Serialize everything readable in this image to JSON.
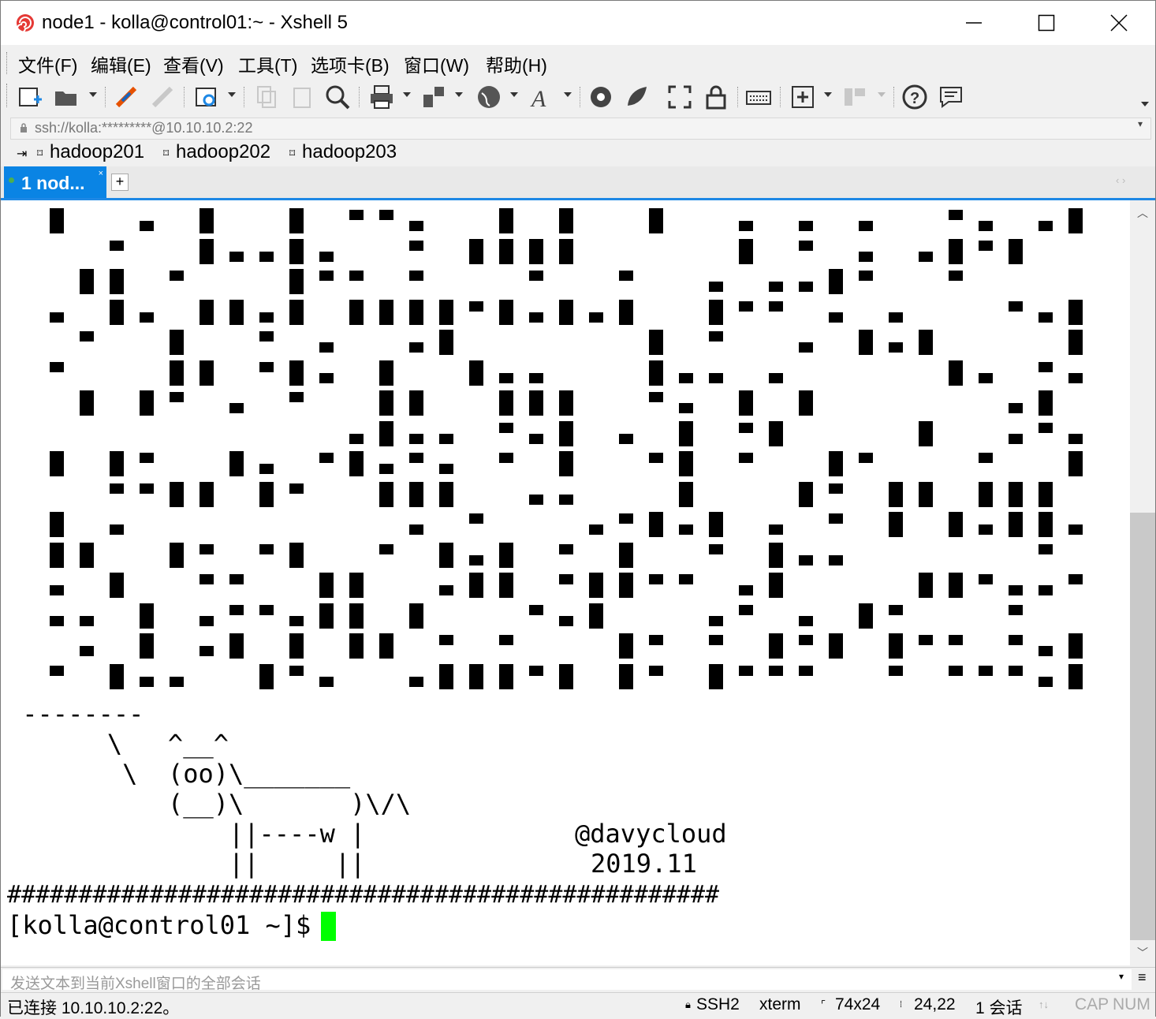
{
  "window": {
    "title": "node1 - kolla@control01:~ - Xshell 5",
    "minimize_glyph": "—",
    "maximize_glyph": "☐",
    "close_glyph": "✕"
  },
  "menu": [
    "文件(F)",
    "编辑(E)",
    "查看(V)",
    "工具(T)",
    "选项卡(B)",
    "窗口(W)",
    "帮助(H)"
  ],
  "toolbar_icons": [
    "new-session-icon",
    "open-folder-icon",
    "connect-icon",
    "disconnect-icon",
    "properties-icon",
    "copy-icon",
    "paste-icon",
    "find-icon",
    "print-icon",
    "transfer-icon",
    "globe-icon",
    "font-icon",
    "xftp-icon",
    "xmanager-icon",
    "fullscreen-icon",
    "lock-icon",
    "keyboard-icon",
    "add-tab-icon",
    "layout-icon",
    "help-icon",
    "chat-icon"
  ],
  "address": {
    "value": "ssh://kolla:*********@10.10.10.2:22"
  },
  "quick_links": [
    "hadoop201",
    "hadoop202",
    "hadoop203"
  ],
  "tab": {
    "label": "1 nod...",
    "close": "×",
    "add": "+"
  },
  "terminal": {
    "dashes": " --------",
    "cow_lines": [
      "       \\   ^__^",
      "        \\  (oo)\\_______",
      "           (__)\\       )\\/\\",
      "               ||----w |",
      "               ||     ||"
    ],
    "signature": "@davycloud",
    "date": "2019.11",
    "hash_line": "##################################################",
    "prompt": "[kolla@control01 ~]$ "
  },
  "compose": {
    "placeholder": "发送文本到当前Xshell窗口的全部会话"
  },
  "status": {
    "connection": "已连接 10.10.10.2:22。",
    "protocol": "SSH2",
    "terminal_type": "xterm",
    "size": "74x24",
    "cursor_pos": "24,22",
    "sessions": "1 会话",
    "caps": "CAP",
    "num": "NUM"
  }
}
